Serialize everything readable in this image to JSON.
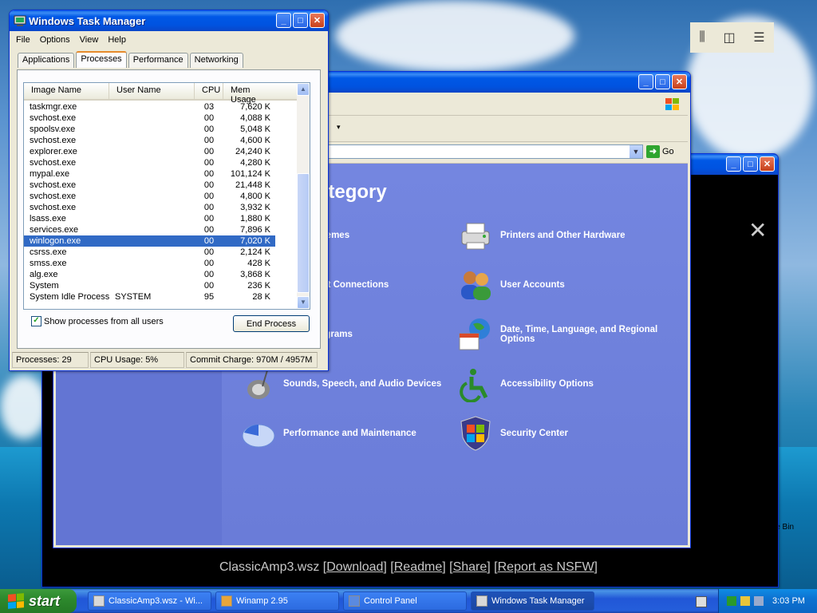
{
  "task_manager": {
    "title": "Windows Task Manager",
    "menu": [
      "File",
      "Options",
      "View",
      "Help"
    ],
    "tabs": [
      "Applications",
      "Processes",
      "Performance",
      "Networking"
    ],
    "columns": [
      "Image Name",
      "User Name",
      "CPU",
      "Mem Usage"
    ],
    "rows": [
      {
        "image": "taskmgr.exe",
        "user": "",
        "cpu": "03",
        "mem": "7,620 K"
      },
      {
        "image": "svchost.exe",
        "user": "",
        "cpu": "00",
        "mem": "4,088 K"
      },
      {
        "image": "spoolsv.exe",
        "user": "",
        "cpu": "00",
        "mem": "5,048 K"
      },
      {
        "image": "svchost.exe",
        "user": "",
        "cpu": "00",
        "mem": "4,600 K"
      },
      {
        "image": "explorer.exe",
        "user": "",
        "cpu": "00",
        "mem": "24,240 K"
      },
      {
        "image": "svchost.exe",
        "user": "",
        "cpu": "00",
        "mem": "4,280 K"
      },
      {
        "image": "mypal.exe",
        "user": "",
        "cpu": "00",
        "mem": "101,124 K"
      },
      {
        "image": "svchost.exe",
        "user": "",
        "cpu": "00",
        "mem": "21,448 K"
      },
      {
        "image": "svchost.exe",
        "user": "",
        "cpu": "00",
        "mem": "4,800 K"
      },
      {
        "image": "svchost.exe",
        "user": "",
        "cpu": "00",
        "mem": "3,932 K"
      },
      {
        "image": "lsass.exe",
        "user": "",
        "cpu": "00",
        "mem": "1,880 K"
      },
      {
        "image": "services.exe",
        "user": "",
        "cpu": "00",
        "mem": "7,896 K"
      },
      {
        "image": "winlogon.exe",
        "user": "",
        "cpu": "00",
        "mem": "7,020 K"
      },
      {
        "image": "csrss.exe",
        "user": "",
        "cpu": "00",
        "mem": "2,124 K"
      },
      {
        "image": "smss.exe",
        "user": "",
        "cpu": "00",
        "mem": "428 K"
      },
      {
        "image": "alg.exe",
        "user": "",
        "cpu": "00",
        "mem": "3,868 K"
      },
      {
        "image": "System",
        "user": "",
        "cpu": "00",
        "mem": "236 K"
      },
      {
        "image": "System Idle Process",
        "user": "SYSTEM",
        "cpu": "95",
        "mem": "28 K"
      }
    ],
    "selected_row": 12,
    "show_all_label": "Show processes from all users",
    "show_all_checked": true,
    "end_process_label": "End Process",
    "status": {
      "processes": "Processes: 29",
      "cpu": "CPU Usage: 5%",
      "commit": "Commit Charge: 970M / 4957M"
    }
  },
  "control_panel": {
    "heading": "ategory",
    "go_label": "Go",
    "categories": [
      {
        "label": "ce and Themes",
        "icon": "appearance-icon"
      },
      {
        "label": "Printers and Other Hardware",
        "icon": "printer-icon"
      },
      {
        "label": "nd Internet Connections",
        "icon": "network-icon"
      },
      {
        "label": "User Accounts",
        "icon": "users-icon"
      },
      {
        "label": "move Programs",
        "icon": "programs-icon"
      },
      {
        "label": "Date, Time, Language, and Regional Options",
        "icon": "globe-calendar-icon"
      },
      {
        "label": "Sounds, Speech, and Audio Devices",
        "icon": "speaker-icon"
      },
      {
        "label": "Accessibility Options",
        "icon": "accessibility-icon"
      },
      {
        "label": "Performance and Maintenance",
        "icon": "pie-chart-icon"
      },
      {
        "label": "Security Center",
        "icon": "shield-icon"
      }
    ]
  },
  "background_window": {
    "caption_file": "ClassicAmp3.wsz",
    "links": [
      "Download",
      "Readme",
      "Share",
      "Report as NSFW"
    ]
  },
  "taskbar": {
    "start_label": "start",
    "buttons": [
      "ClassicAmp3.wsz - Wi...",
      "Winamp 2.95",
      "Control Panel",
      "Windows Task Manager"
    ],
    "active": 3,
    "clock": "3:03 PM"
  },
  "desktop": {
    "recycle_partial": "le Bin"
  },
  "colors": {
    "xp_blue": "#0058e6",
    "selection": "#316ac5",
    "start_green": "#2d892d",
    "cp_blue": "#6b7fd6"
  }
}
